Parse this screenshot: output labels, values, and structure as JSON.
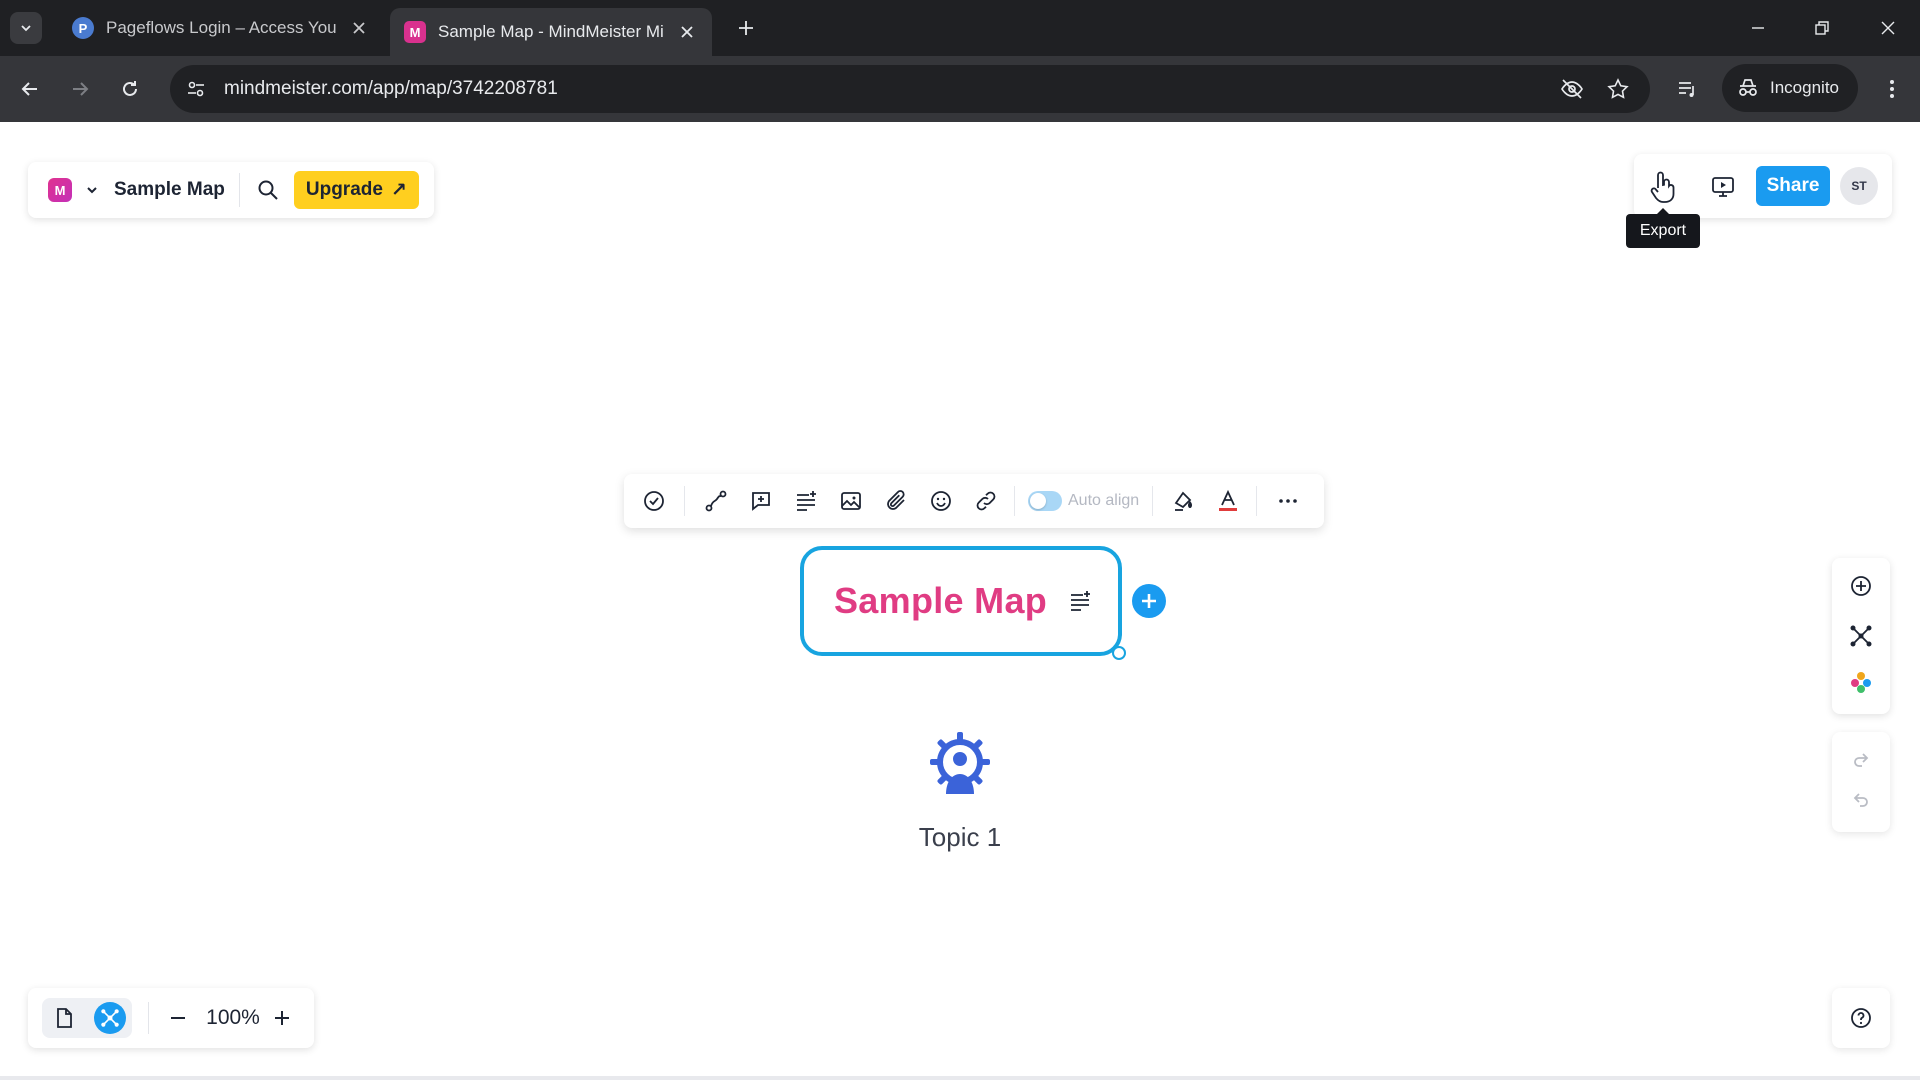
{
  "browser": {
    "tabs": [
      {
        "title": "Pageflows Login – Access Your",
        "favicon_letter": "P",
        "favicon_color": "#4a7bd0",
        "active": false
      },
      {
        "title": "Sample Map - MindMeister Mi",
        "favicon_letter": "M",
        "favicon_color": "#d9318e",
        "active": true
      }
    ],
    "url": "mindmeister.com/app/map/3742208781",
    "incognito_label": "Incognito"
  },
  "app": {
    "logo_letter": "M",
    "map_name": "Sample Map",
    "upgrade_label": "Upgrade",
    "upgrade_arrow": "↗",
    "share_label": "Share",
    "avatar_initials": "ST",
    "tooltip": "Export",
    "topic_toolbar": {
      "auto_align_label": "Auto align",
      "auto_align_on": true
    },
    "root_topic": {
      "title": "Sample Map",
      "title_color": "#e03c83",
      "border_color": "#18a4e0"
    },
    "child_topic": {
      "label": "Topic 1",
      "icon": "gear-person-icon",
      "icon_color": "#3b63d9"
    },
    "zoom": {
      "level": "100%"
    },
    "colors": {
      "accent": "#1a9bf0",
      "upgrade": "#ffcf1f"
    }
  }
}
